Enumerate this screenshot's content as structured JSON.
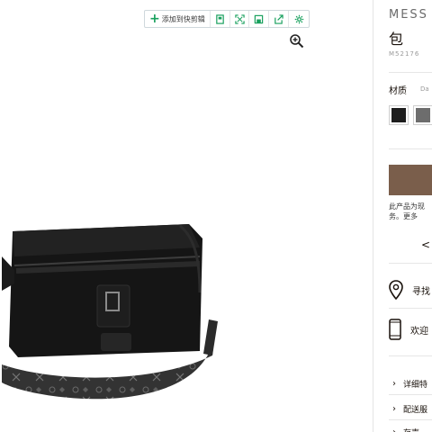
{
  "toolbar": {
    "add_label": "添加到快剪辑",
    "icons": [
      "plus-icon",
      "bookmark-icon",
      "fullscreen-icon",
      "save-icon",
      "share-icon",
      "settings-icon"
    ]
  },
  "image_area": {
    "zoom_icon": "zoom-in-icon",
    "product_image": "messenger-bag"
  },
  "product": {
    "title": "MESS",
    "subtitle": "包",
    "sku": "M52176",
    "material_label": "材质",
    "material_value": "Da",
    "swatches": [
      {
        "color": "#1d1d1d",
        "selected": true
      },
      {
        "color": "#6d6d6d",
        "selected": false
      }
    ],
    "cta_color": "#7a5e4b",
    "note_line1": "此产品为现",
    "note_line2": "务。更多",
    "share_glyph": "<",
    "services": [
      {
        "icon": "location-pin-icon",
        "label": "寻找"
      },
      {
        "icon": "phone-icon",
        "label": "欢迎"
      }
    ],
    "links": [
      {
        "label": "详细特"
      },
      {
        "label": "配送服"
      },
      {
        "label": "存声"
      }
    ]
  }
}
